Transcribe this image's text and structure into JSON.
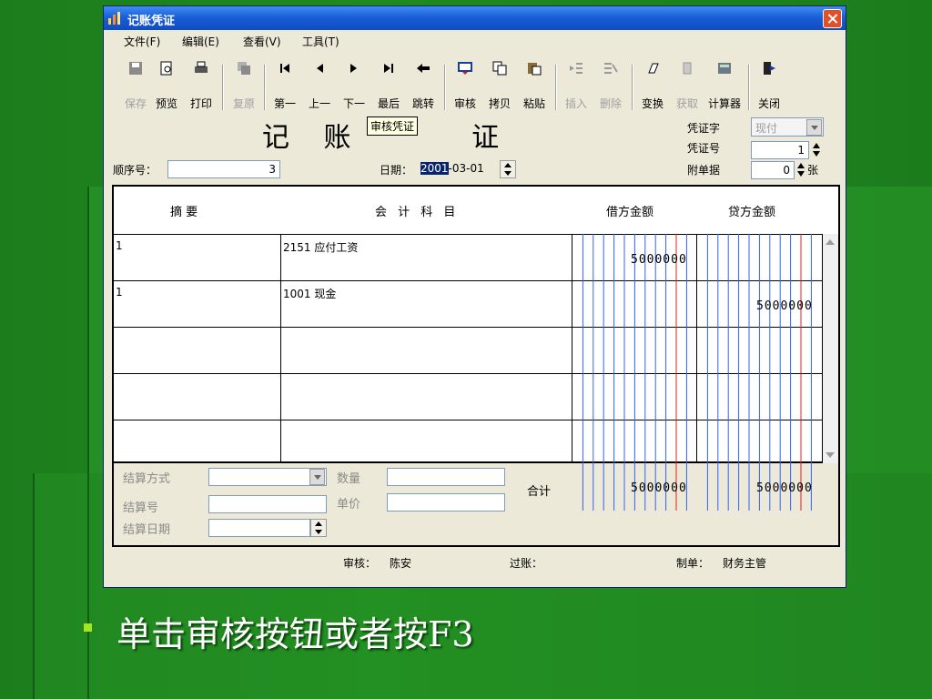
{
  "window": {
    "title": "记账凭证",
    "accent": "#1a5fd8"
  },
  "menu": [
    "文件(F)",
    "编辑(E)",
    "查看(V)",
    "工具(T)"
  ],
  "toolbar": {
    "buttons": [
      {
        "label": "保存",
        "icon": "save-icon",
        "enabled": false
      },
      {
        "label": "预览",
        "icon": "preview-icon",
        "enabled": true
      },
      {
        "label": "打印",
        "icon": "print-icon",
        "enabled": true
      },
      {
        "label": "复原",
        "icon": "restore-icon",
        "enabled": false
      },
      {
        "label": "第一",
        "icon": "first-icon",
        "enabled": true
      },
      {
        "label": "上一",
        "icon": "prev-icon",
        "enabled": true
      },
      {
        "label": "下一",
        "icon": "next-icon",
        "enabled": true
      },
      {
        "label": "最后",
        "icon": "last-icon",
        "enabled": true
      },
      {
        "label": "跳转",
        "icon": "jump-icon",
        "enabled": true
      },
      {
        "label": "审核",
        "icon": "audit-icon",
        "enabled": true
      },
      {
        "label": "拷贝",
        "icon": "copy-icon",
        "enabled": true
      },
      {
        "label": "粘贴",
        "icon": "paste-icon",
        "enabled": true
      },
      {
        "label": "插入",
        "icon": "insert-icon",
        "enabled": false
      },
      {
        "label": "删除",
        "icon": "delete-icon",
        "enabled": false
      },
      {
        "label": "变换",
        "icon": "transform-icon",
        "enabled": true
      },
      {
        "label": "获取",
        "icon": "fetch-icon",
        "enabled": false
      },
      {
        "label": "计算器",
        "icon": "calculator-icon",
        "enabled": true
      },
      {
        "label": "关闭",
        "icon": "exit-icon",
        "enabled": true
      }
    ]
  },
  "voucher": {
    "title_left": "记  账",
    "title_right": "证",
    "tooltip": "审核凭证",
    "seq_label": "顺序号：",
    "seq_value": "3",
    "date_label": "日期：",
    "date_year": "2001",
    "date_rest": "-03-01",
    "type_label": "凭证字",
    "type_value": "现付",
    "number_label": "凭证号",
    "number_value": "1",
    "attach_label": "附单据",
    "attach_value": "0",
    "attach_unit": "张"
  },
  "grid": {
    "headers": {
      "summary": "摘  要",
      "account": "会 计 科 目",
      "debit": "借方金额",
      "credit": "贷方金额"
    },
    "rows": [
      {
        "summary": "1",
        "account": "2151 应付工资",
        "debit": "5000000",
        "credit": ""
      },
      {
        "summary": "1",
        "account": "1001 现金",
        "debit": "",
        "credit": "5000000"
      },
      {
        "summary": "",
        "account": "",
        "debit": "",
        "credit": ""
      },
      {
        "summary": "",
        "account": "",
        "debit": "",
        "credit": ""
      },
      {
        "summary": "",
        "account": "",
        "debit": "",
        "credit": ""
      }
    ]
  },
  "footer": {
    "settle_method": "结算方式",
    "settle_no": "结算号",
    "settle_date": "结算日期",
    "quantity": "数量",
    "unit_price": "单价",
    "total_label": "合计",
    "total_debit": "5000000",
    "total_credit": "5000000",
    "auditor_label": "审核：",
    "auditor": "陈安",
    "posted_label": "过账：",
    "maker_label": "制单：",
    "maker": "财务主管"
  },
  "caption": "单击审核按钮或者按F3"
}
